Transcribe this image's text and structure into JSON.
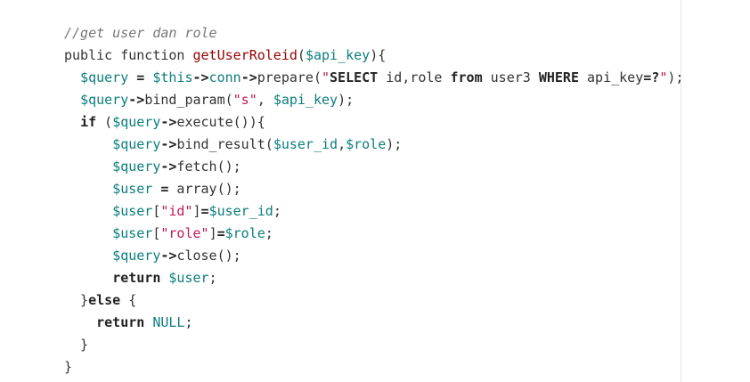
{
  "colors": {
    "background": "#ffffff",
    "text": "#333333",
    "comment": "#777777",
    "function_name": "#990000",
    "variable": "#0c7d7d",
    "string": "#c2185b",
    "keyword": "#222222",
    "rule": "#e6e6e6"
  },
  "code": {
    "lines": [
      [
        {
          "t": "//get user dan role",
          "k": "comment"
        }
      ],
      [
        {
          "t": "public function ",
          "k": "plain"
        },
        {
          "t": "getUserRoleid",
          "k": "func"
        },
        {
          "t": "(",
          "k": "plain"
        },
        {
          "t": "$api_key",
          "k": "var"
        },
        {
          "t": "){",
          "k": "plain"
        }
      ],
      [
        {
          "t": "  ",
          "k": "plain"
        },
        {
          "t": "$query",
          "k": "var"
        },
        {
          "t": " ",
          "k": "plain"
        },
        {
          "t": "=",
          "k": "kw"
        },
        {
          "t": " ",
          "k": "plain"
        },
        {
          "t": "$this",
          "k": "var"
        },
        {
          "t": "->",
          "k": "kw"
        },
        {
          "t": "conn",
          "k": "var"
        },
        {
          "t": "->",
          "k": "kw"
        },
        {
          "t": "prepare(",
          "k": "plain"
        },
        {
          "t": "\"",
          "k": "str"
        },
        {
          "t": "SELECT",
          "k": "sqlkw"
        },
        {
          "t": " id,role ",
          "k": "plain"
        },
        {
          "t": "from",
          "k": "sqlkw"
        },
        {
          "t": " user3 ",
          "k": "plain"
        },
        {
          "t": "WHERE",
          "k": "sqlkw"
        },
        {
          "t": " api_key",
          "k": "plain"
        },
        {
          "t": "=?",
          "k": "kw"
        },
        {
          "t": "\"",
          "k": "str"
        },
        {
          "t": ");",
          "k": "plain"
        }
      ],
      [
        {
          "t": "  ",
          "k": "plain"
        },
        {
          "t": "$query",
          "k": "var"
        },
        {
          "t": "->",
          "k": "kw"
        },
        {
          "t": "bind_param(",
          "k": "plain"
        },
        {
          "t": "\"s\"",
          "k": "str"
        },
        {
          "t": ", ",
          "k": "plain"
        },
        {
          "t": "$api_key",
          "k": "var"
        },
        {
          "t": ");",
          "k": "plain"
        }
      ],
      [
        {
          "t": "  ",
          "k": "plain"
        },
        {
          "t": "if",
          "k": "kw"
        },
        {
          "t": " (",
          "k": "plain"
        },
        {
          "t": "$query",
          "k": "var"
        },
        {
          "t": "->",
          "k": "kw"
        },
        {
          "t": "execute()){",
          "k": "plain"
        }
      ],
      [
        {
          "t": "      ",
          "k": "plain"
        },
        {
          "t": "$query",
          "k": "var"
        },
        {
          "t": "->",
          "k": "kw"
        },
        {
          "t": "bind_result(",
          "k": "plain"
        },
        {
          "t": "$user_id",
          "k": "var"
        },
        {
          "t": ",",
          "k": "plain"
        },
        {
          "t": "$role",
          "k": "var"
        },
        {
          "t": ");",
          "k": "plain"
        }
      ],
      [
        {
          "t": "      ",
          "k": "plain"
        },
        {
          "t": "$query",
          "k": "var"
        },
        {
          "t": "->",
          "k": "kw"
        },
        {
          "t": "fetch();",
          "k": "plain"
        }
      ],
      [
        {
          "t": "      ",
          "k": "plain"
        },
        {
          "t": "$user",
          "k": "var"
        },
        {
          "t": " ",
          "k": "plain"
        },
        {
          "t": "=",
          "k": "kw"
        },
        {
          "t": " array();",
          "k": "plain"
        }
      ],
      [
        {
          "t": "      ",
          "k": "plain"
        },
        {
          "t": "$user",
          "k": "var"
        },
        {
          "t": "[",
          "k": "plain"
        },
        {
          "t": "\"id\"",
          "k": "str"
        },
        {
          "t": "]",
          "k": "plain"
        },
        {
          "t": "=",
          "k": "kw"
        },
        {
          "t": "$user_id",
          "k": "var"
        },
        {
          "t": ";",
          "k": "plain"
        }
      ],
      [
        {
          "t": "      ",
          "k": "plain"
        },
        {
          "t": "$user",
          "k": "var"
        },
        {
          "t": "[",
          "k": "plain"
        },
        {
          "t": "\"role\"",
          "k": "str"
        },
        {
          "t": "]",
          "k": "plain"
        },
        {
          "t": "=",
          "k": "kw"
        },
        {
          "t": "$role",
          "k": "var"
        },
        {
          "t": ";",
          "k": "plain"
        }
      ],
      [
        {
          "t": "      ",
          "k": "plain"
        },
        {
          "t": "$query",
          "k": "var"
        },
        {
          "t": "->",
          "k": "kw"
        },
        {
          "t": "close();",
          "k": "plain"
        }
      ],
      [
        {
          "t": "      ",
          "k": "plain"
        },
        {
          "t": "return",
          "k": "kw"
        },
        {
          "t": " ",
          "k": "plain"
        },
        {
          "t": "$user",
          "k": "var"
        },
        {
          "t": ";",
          "k": "plain"
        }
      ],
      [
        {
          "t": "  }",
          "k": "plain"
        },
        {
          "t": "else",
          "k": "kw"
        },
        {
          "t": " {",
          "k": "plain"
        }
      ],
      [
        {
          "t": "    ",
          "k": "plain"
        },
        {
          "t": "return",
          "k": "kw"
        },
        {
          "t": " ",
          "k": "plain"
        },
        {
          "t": "NULL",
          "k": "null"
        },
        {
          "t": ";",
          "k": "plain"
        }
      ],
      [
        {
          "t": "  }",
          "k": "plain"
        }
      ],
      [
        {
          "t": "}",
          "k": "plain"
        }
      ]
    ]
  }
}
